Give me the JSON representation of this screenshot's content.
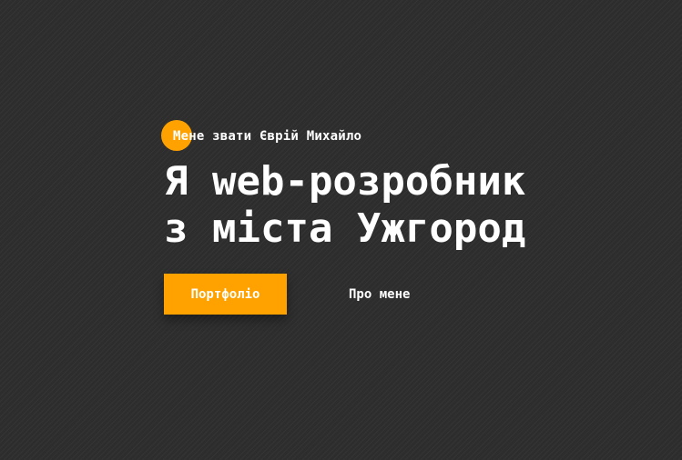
{
  "hero": {
    "intro": "Мене звати Єврій Михайло",
    "headline_line1": "Я web-розробник",
    "headline_line2": "з міста Ужгород",
    "primary_button": "Портфоліо",
    "secondary_link": "Про мене"
  },
  "colors": {
    "accent": "#ffa200",
    "background": "#2d2d2d",
    "text": "#ffffff"
  }
}
